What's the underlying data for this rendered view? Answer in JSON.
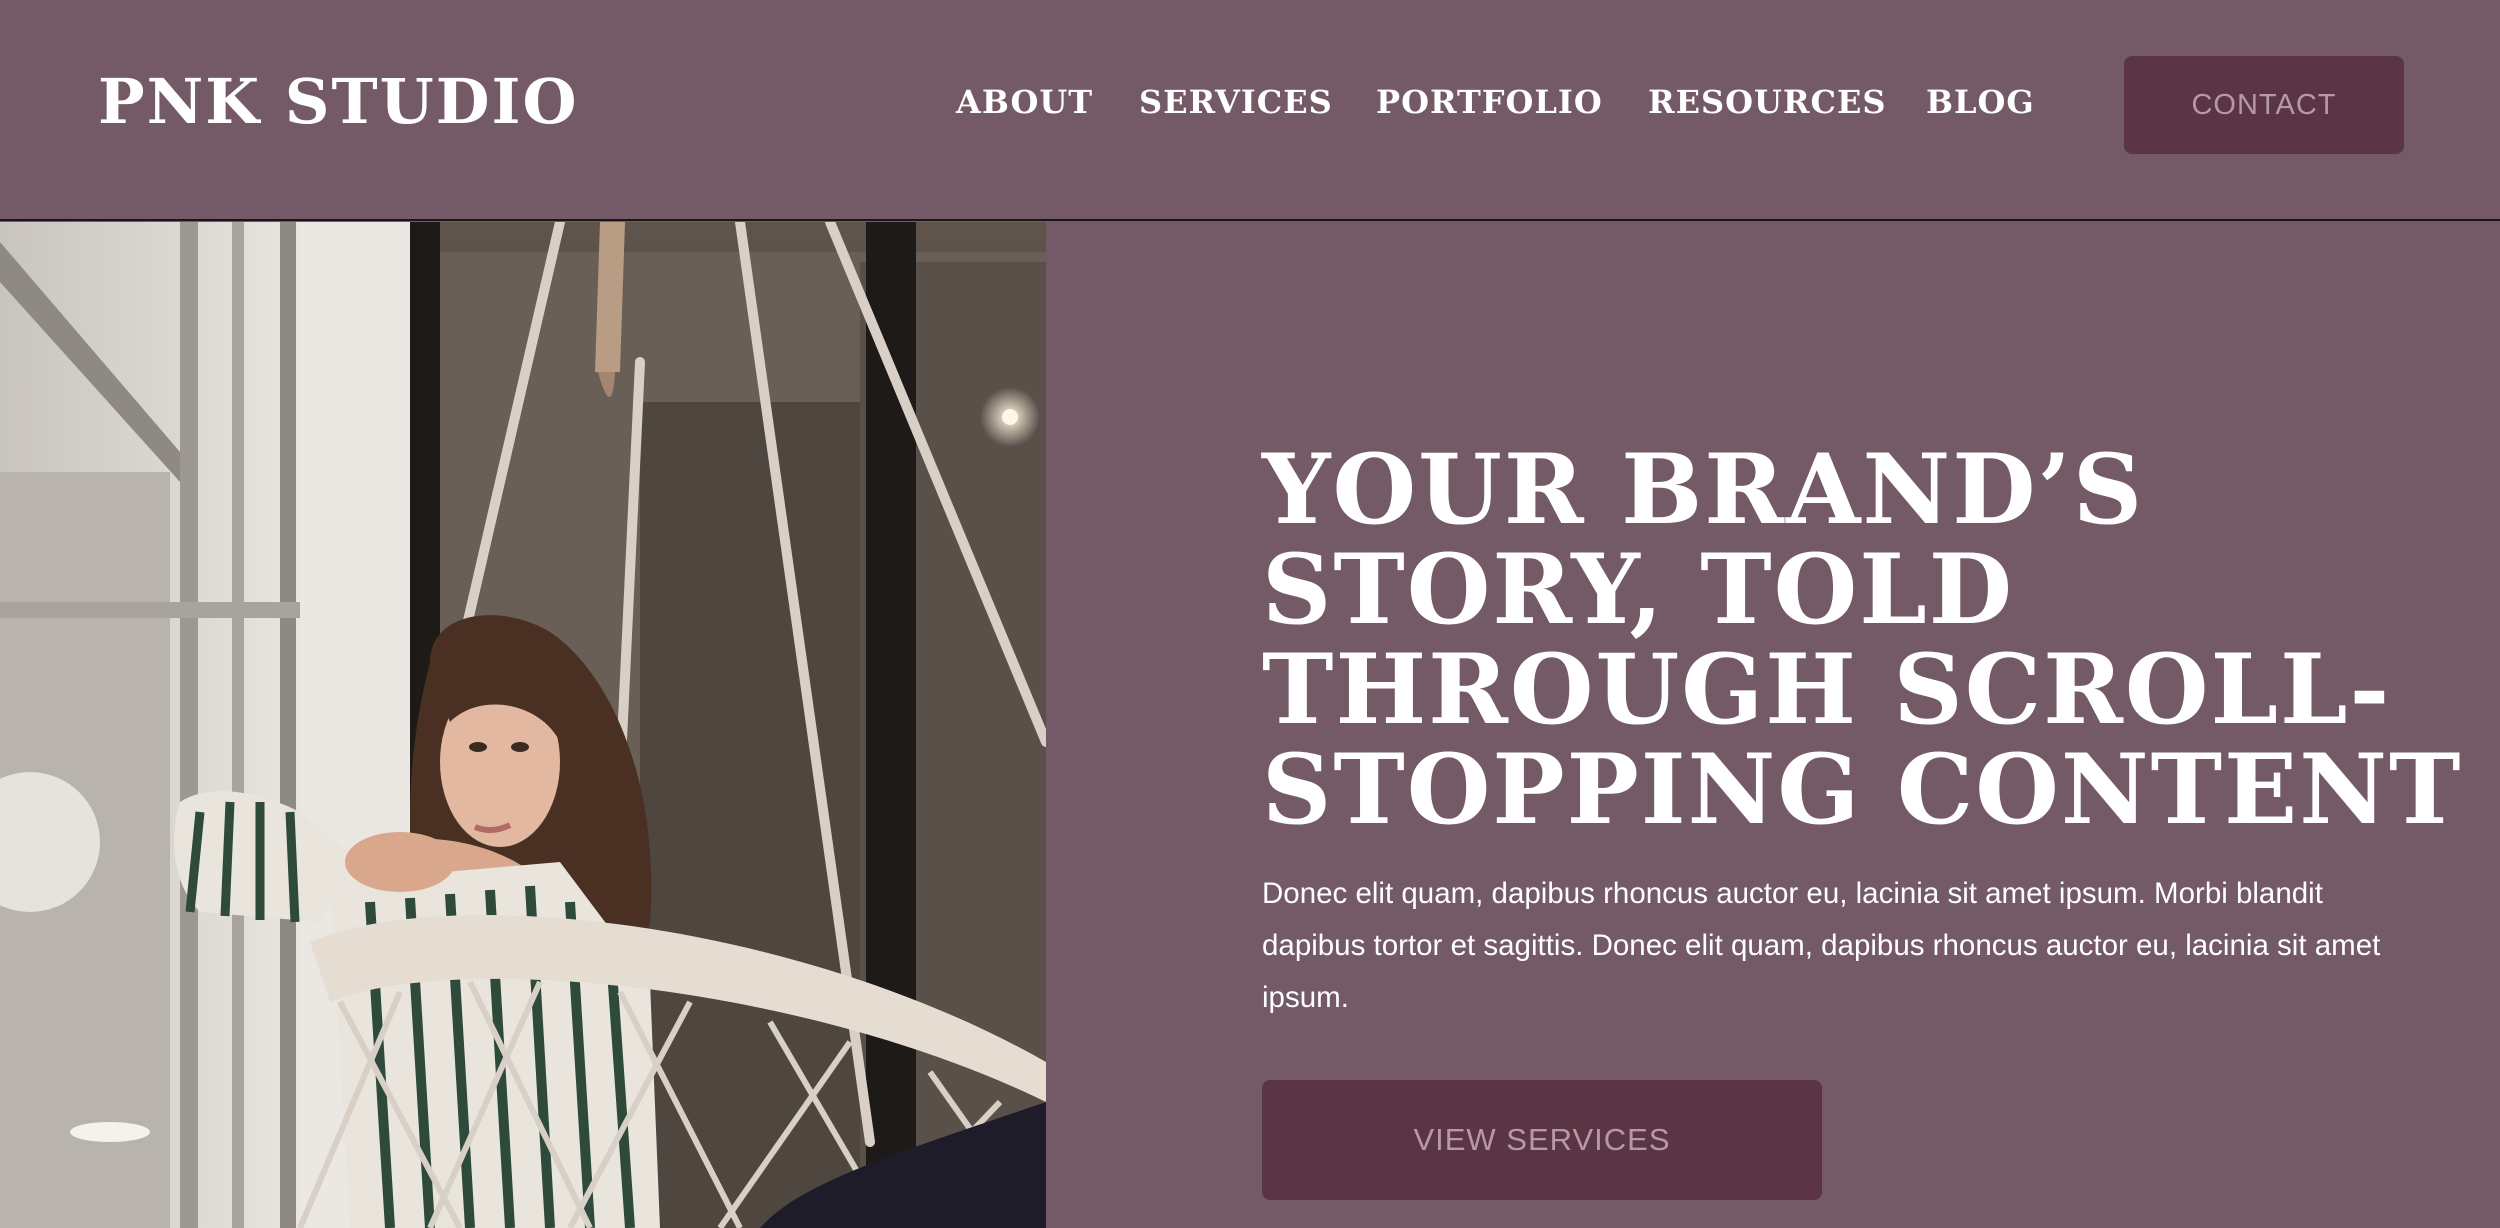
{
  "header": {
    "logo": "PNK STUDIO",
    "nav": {
      "about": "ABOUT",
      "services": "SERVICES",
      "portfolio": "PORTFOLIO",
      "resources": "RESOURCES",
      "blog": "BLOG"
    },
    "contact_label": "CONTACT"
  },
  "hero": {
    "heading_lines": [
      "YOUR BRAND’S",
      "STORY, TOLD",
      "THROUGH SCROLL-",
      "STOPPING CONTENT"
    ],
    "body": "Donec elit quam, dapibus rhoncus auctor eu, lacinia sit amet ipsum. Morbi blandit dapibus tortor et sagittis. Donec elit quam, dapibus rhoncus auctor eu, lacinia sit amet ipsum.",
    "cta_label": "VIEW SERVICES"
  },
  "colors": {
    "background": "#735a66",
    "button": "#5c3544",
    "button_text": "#b59aa6",
    "text": "#ffffff"
  }
}
